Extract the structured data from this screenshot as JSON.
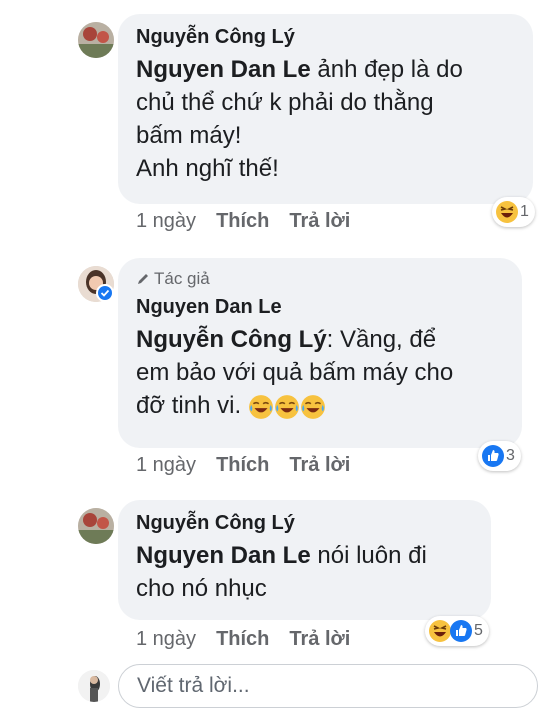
{
  "comments": [
    {
      "author": "Nguyễn Công Lý",
      "mention": "Nguyen Dan Le",
      "text_lines": [
        " ảnh đẹp là do",
        "chủ thể chứ k phải do thằng",
        "bấm máy!",
        "Anh nghĩ thế!"
      ],
      "time": "1 ngày",
      "like": "Thích",
      "reply": "Trả lời",
      "reaction_count": "1",
      "reaction_icons": [
        "laugh-emoji-icon"
      ]
    },
    {
      "badge": "Tác giả",
      "author": "Nguyen Dan Le",
      "mention": "Nguyễn Công Lý",
      "text_lines": [
        ": Vầng, để",
        "em bảo với quả bấm máy cho",
        "đỡ tinh vi. "
      ],
      "time": "1 ngày",
      "like": "Thích",
      "reply": "Trả lời",
      "reaction_count": "3",
      "reaction_icons": [
        "like-icon"
      ]
    },
    {
      "author": "Nguyễn Công Lý",
      "mention": "Nguyen Dan Le",
      "text_lines": [
        " nói luôn đi",
        "cho nó nhục"
      ],
      "time": "1 ngày",
      "like": "Thích",
      "reply": "Trả lời",
      "reaction_count": "5",
      "reaction_icons": [
        "laugh-emoji-icon",
        "like-icon"
      ]
    }
  ],
  "reply_box": {
    "placeholder": "Viết trả lời..."
  },
  "colors": {
    "bubble": "#f0f2f5",
    "muted": "#65676b",
    "like_blue": "#1877f2",
    "emoji_yellow": "#f7c23f"
  }
}
